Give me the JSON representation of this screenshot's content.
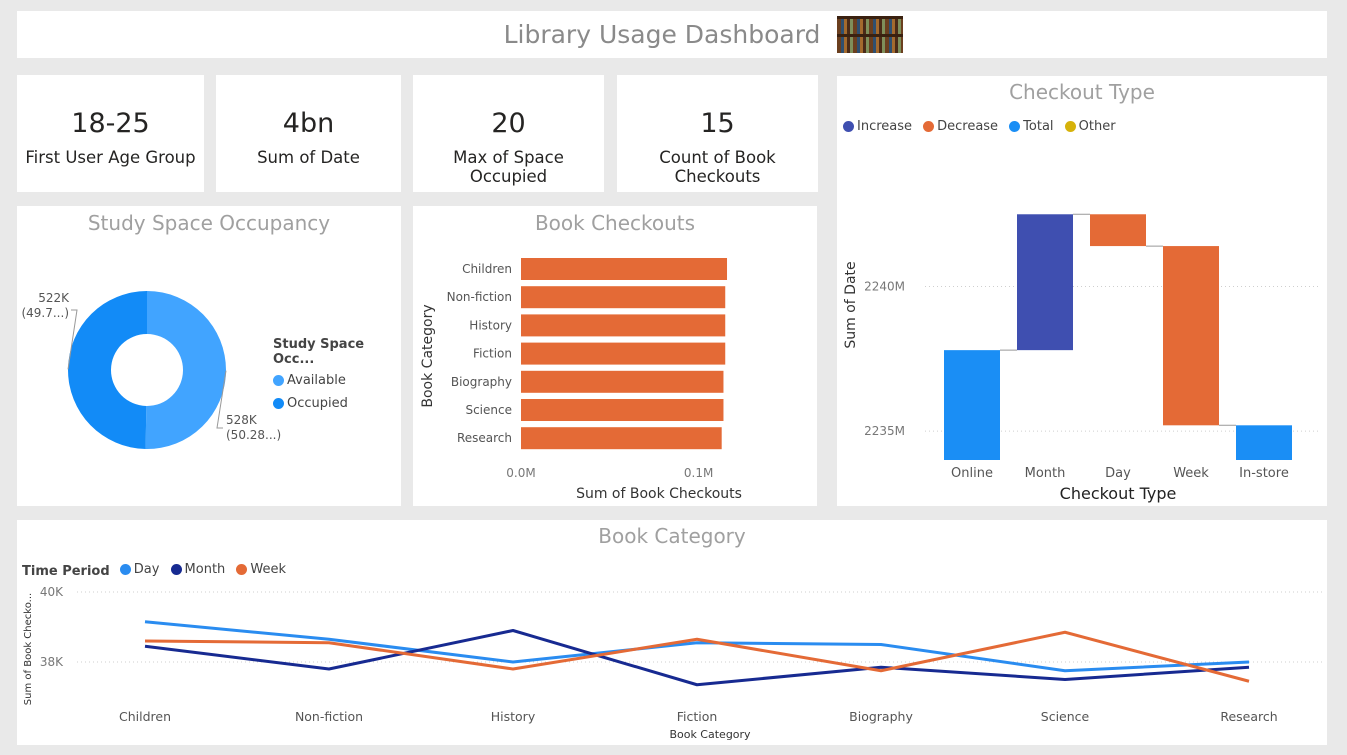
{
  "header": {
    "title": "Library Usage Dashboard"
  },
  "kpis": [
    {
      "value": "18-25",
      "label": "First User Age Group"
    },
    {
      "value": "4bn",
      "label": "Sum of Date"
    },
    {
      "value": "20",
      "label": "Max of Space Occupied"
    },
    {
      "value": "15",
      "label": "Count of Book Checkouts"
    }
  ],
  "colors": {
    "increase": "#3f4fb0",
    "decrease": "#e46a36",
    "total": "#1a8ef5",
    "other": "#d6b20a",
    "available": "#41a4ff",
    "occupied": "#128bf7",
    "day": "#2a8cf0",
    "month": "#172a91",
    "week": "#e46a36",
    "bar": "#e46a36"
  },
  "chart_data": [
    {
      "type": "pie",
      "title": "Study Space Occupancy",
      "legend_title": "Study Space Occ...",
      "categories": [
        "Available",
        "Occupied"
      ],
      "values": [
        528000,
        522000
      ],
      "data_labels": [
        {
          "value": "528K",
          "pct": "(50.28...)"
        },
        {
          "value": "522K",
          "pct": "(49.7...)"
        }
      ]
    },
    {
      "type": "bar",
      "orientation": "horizontal",
      "title": "Book Checkouts",
      "categories": [
        "Children",
        "Non-fiction",
        "History",
        "Fiction",
        "Biography",
        "Science",
        "Research"
      ],
      "values": [
        0.116,
        0.115,
        0.115,
        0.115,
        0.114,
        0.114,
        0.113
      ],
      "xlabel": "Sum of Book Checkouts",
      "ylabel": "Book Category",
      "xticks": [
        "0.0M",
        "0.1M"
      ],
      "xlim": [
        0,
        0.125
      ]
    },
    {
      "type": "bar",
      "subtype": "waterfall",
      "title": "Checkout Type",
      "legend": [
        "Increase",
        "Decrease",
        "Total",
        "Other"
      ],
      "categories": [
        "Online",
        "Month",
        "Day",
        "Week",
        "In-store"
      ],
      "steps": [
        {
          "kind": "total",
          "start": 2234.0,
          "end": 2237.8
        },
        {
          "kind": "increase",
          "start": 2237.8,
          "end": 2242.5
        },
        {
          "kind": "decrease",
          "start": 2242.5,
          "end": 2241.4
        },
        {
          "kind": "decrease",
          "start": 2241.4,
          "end": 2235.2
        },
        {
          "kind": "total",
          "start": 2234.0,
          "end": 2235.2
        }
      ],
      "xlabel": "Checkout Type",
      "ylabel": "Sum of Date",
      "yticks": [
        {
          "value": 2240,
          "label": "2240M"
        },
        {
          "value": 2235,
          "label": "2235M"
        }
      ],
      "ylim": [
        2234.0,
        2245.0
      ]
    },
    {
      "type": "line",
      "title": "Book Category",
      "legend_title": "Time Period",
      "categories": [
        "Children",
        "Non-fiction",
        "History",
        "Fiction",
        "Biography",
        "Science",
        "Research"
      ],
      "series": [
        {
          "name": "Day",
          "values": [
            39150,
            38650,
            38000,
            38550,
            38500,
            37750,
            38000
          ]
        },
        {
          "name": "Month",
          "values": [
            38450,
            37800,
            38900,
            37350,
            37850,
            37500,
            37850
          ]
        },
        {
          "name": "Week",
          "values": [
            38600,
            38550,
            37800,
            38650,
            37750,
            38850,
            37450
          ]
        }
      ],
      "xlabel": "Book Category",
      "ylabel": "Sum of Book Checko...",
      "yticks": [
        {
          "value": 40000,
          "label": "40K"
        },
        {
          "value": 38000,
          "label": "38K"
        }
      ],
      "ylim": [
        36800,
        40000
      ]
    }
  ]
}
